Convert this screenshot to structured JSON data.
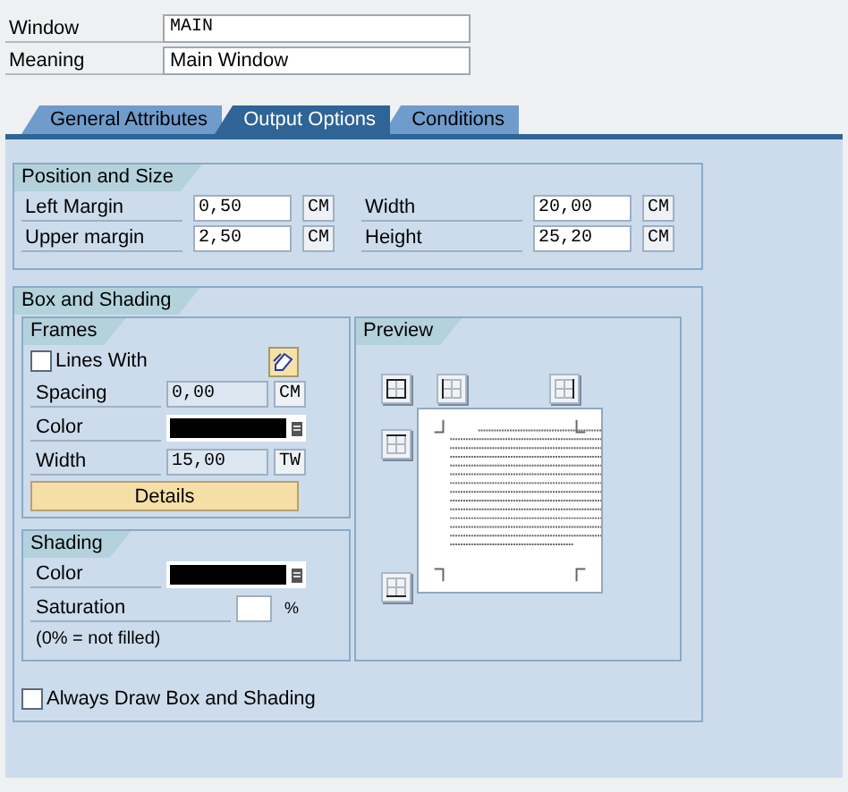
{
  "header": [
    {
      "label": "Window",
      "value": "MAIN",
      "kind": "code"
    },
    {
      "label": "Meaning",
      "value": "Main Window",
      "kind": "text"
    }
  ],
  "tabs": [
    {
      "label": "General Attributes",
      "selected": false
    },
    {
      "label": "Output Options",
      "selected": true
    },
    {
      "label": "Conditions",
      "selected": false
    }
  ],
  "position_size": {
    "title": "Position and Size",
    "fields": [
      {
        "label": "Left Margin",
        "value": "0,50",
        "unit": "CM"
      },
      {
        "label": "Width",
        "value": "20,00",
        "unit": "CM"
      },
      {
        "label": "Upper margin",
        "value": "2,50",
        "unit": "CM"
      },
      {
        "label": "Height",
        "value": "25,20",
        "unit": "CM"
      }
    ]
  },
  "box_shading": {
    "title": "Box and Shading",
    "frames": {
      "title": "Frames",
      "lines_with": {
        "label": "Lines With",
        "checked": false
      },
      "rows": [
        {
          "kind": "field",
          "label": "Spacing",
          "value": "0,00",
          "unit": "CM",
          "disabled": true
        },
        {
          "kind": "color",
          "label": "Color",
          "color": "#000000"
        },
        {
          "kind": "field",
          "label": "Width",
          "value": "15,00",
          "unit": "TW",
          "disabled": true
        }
      ],
      "details": "Details"
    },
    "shading": {
      "title": "Shading",
      "rows": [
        {
          "kind": "color",
          "label": "Color",
          "color": "#000000"
        },
        {
          "kind": "percent",
          "label": "Saturation",
          "unit": "%"
        }
      ],
      "note": "(0% = not filled)"
    },
    "preview": {
      "title": "Preview"
    },
    "always": {
      "label": "Always Draw Box and Shading",
      "checked": false
    }
  }
}
